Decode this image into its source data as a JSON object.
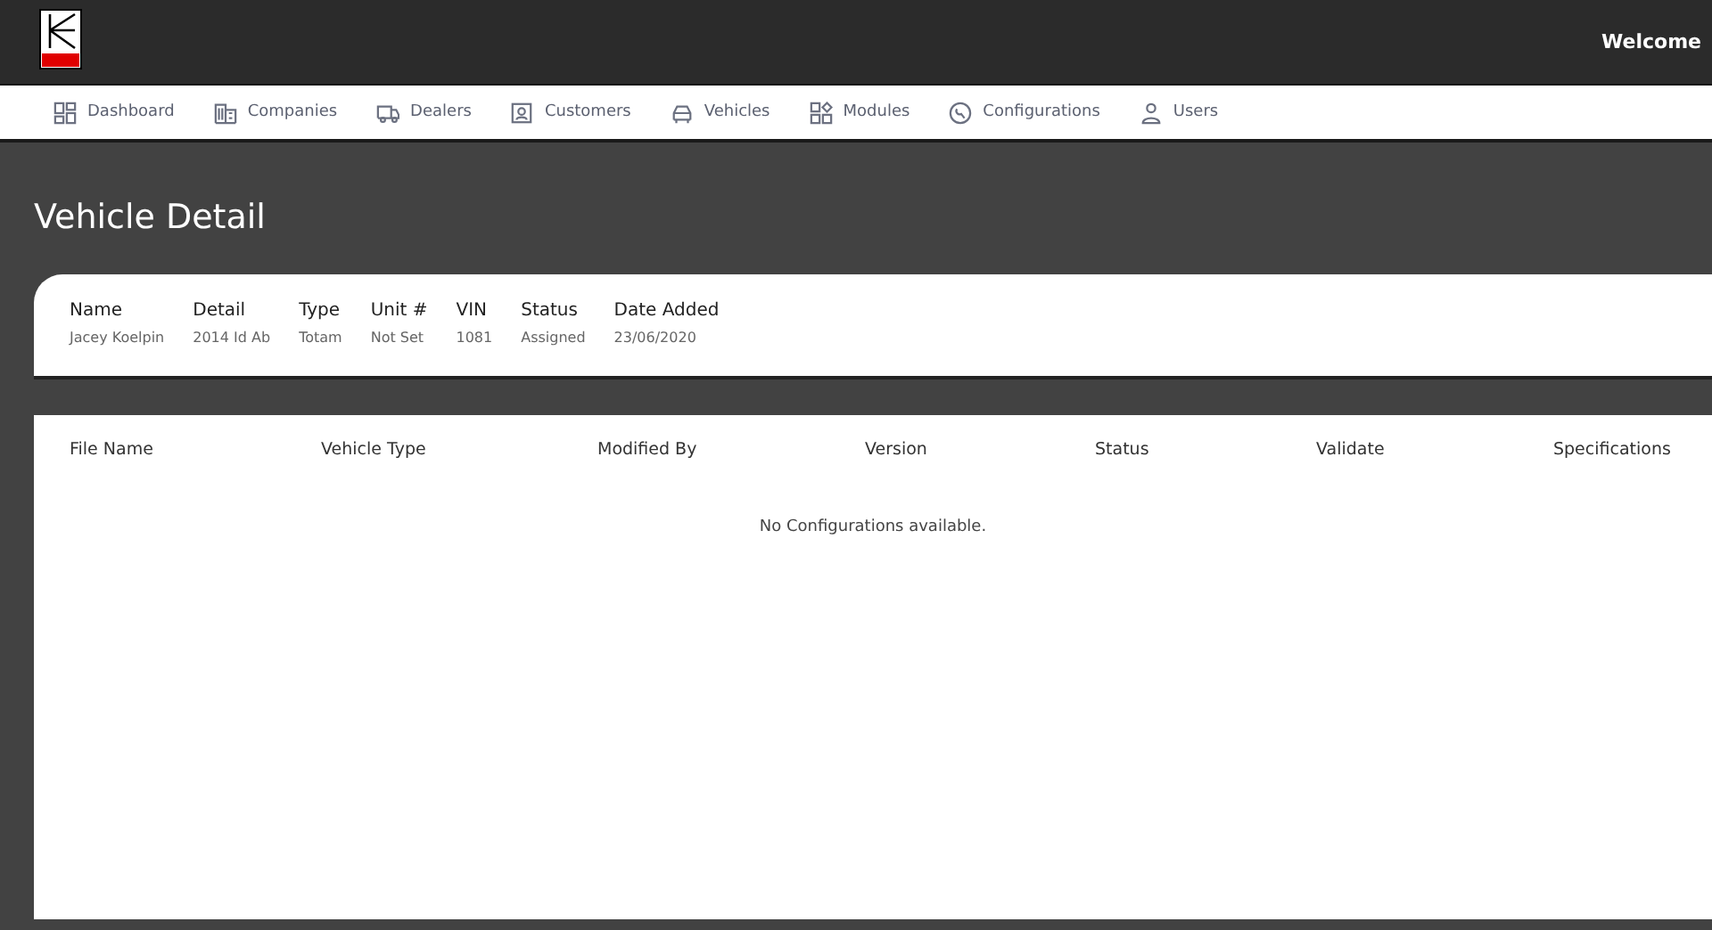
{
  "header": {
    "welcome": "Welcome"
  },
  "nav": [
    {
      "label": "Dashboard"
    },
    {
      "label": "Companies"
    },
    {
      "label": "Dealers"
    },
    {
      "label": "Customers"
    },
    {
      "label": "Vehicles"
    },
    {
      "label": "Modules"
    },
    {
      "label": "Configurations"
    },
    {
      "label": "Users"
    }
  ],
  "page_title": "Vehicle Detail",
  "details": [
    {
      "label": "Name",
      "value": "Jacey Koelpin"
    },
    {
      "label": "Detail",
      "value": "2014 Id Ab"
    },
    {
      "label": "Type",
      "value": "Totam"
    },
    {
      "label": "Unit #",
      "value": "Not Set"
    },
    {
      "label": "VIN",
      "value": "1081"
    },
    {
      "label": "Status",
      "value": "Assigned"
    },
    {
      "label": "Date Added",
      "value": "23/06/2020"
    }
  ],
  "table": {
    "columns": [
      "File Name",
      "Vehicle Type",
      "Modified By",
      "Version",
      "Status",
      "Validate",
      "Specifications"
    ],
    "empty_message": "No Configurations available."
  }
}
